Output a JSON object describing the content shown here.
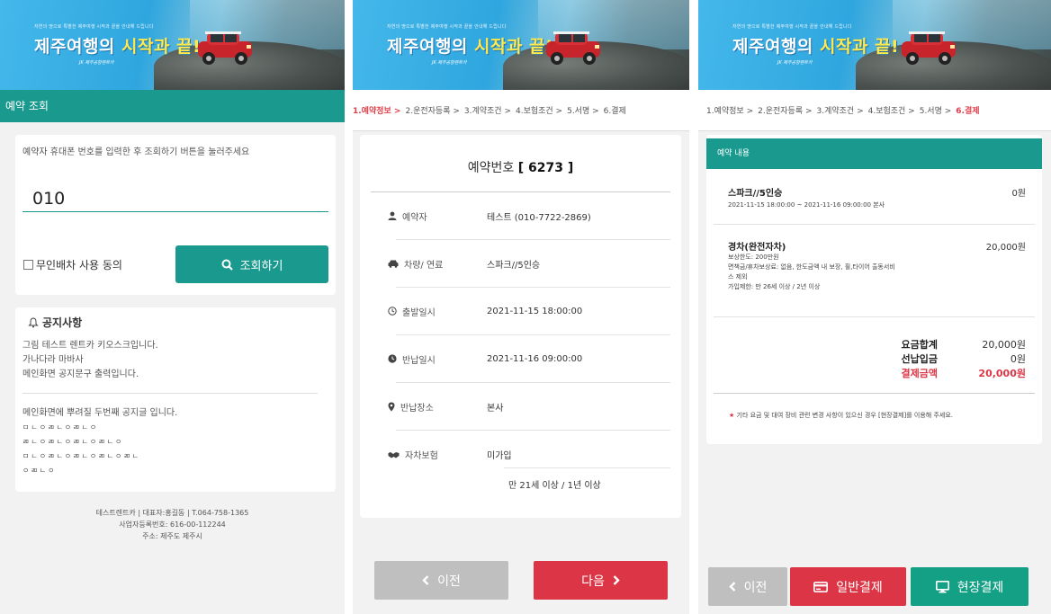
{
  "banner": {
    "small_text": "자연의 땅으로 특별한 제주여행 시작과 끝을 안내해 드립니다",
    "title_part1": "제주여행의 ",
    "title_part2": "시작과 끝!",
    "logo_text": "JK 제주공항렌트카"
  },
  "panel1": {
    "header": "예약 조회",
    "instruction": "예약자 휴대폰 번호를 입력한 후 조회하기 버튼을 눌러주세요",
    "phone_value": "010",
    "agree_label": "무인배차 사용 동의",
    "search_button": "조회하기",
    "notice_title": "공지사항",
    "notice_lines": [
      "그림 테스트 렌트카 키오스크입니다.",
      "가나다라 마바사",
      "메인화면 공지문구 출력입니다."
    ],
    "notice2_title": "메인화면에 뿌려질 두번째 공지글 입니다.",
    "notice2_jamo": [
      "ㅁㄴㅇㄻㄴㅇㄻㄴㅇ",
      "ㄻㄴㅇㄻㄴㅇㄻㄴㅇㄻㄴㅇ",
      "ㅁㄴㅇㄻㄴㅇㄻㄴㅇㄻㄴㅇㄻㄴ",
      "ㅇㄻㄴㅇ"
    ],
    "footer": [
      "테스트렌트카 | 대표자:홍길동 | T.064-758-1365",
      "사업자등록번호: 616-00-112244",
      "주소: 제주도 제주시"
    ]
  },
  "steps": [
    "1.예약정보 >",
    "2.운전자등록 >",
    "3.계약조건 >",
    "4.보험조건 >",
    "5.서명 >",
    "6.결제"
  ],
  "panel2": {
    "title_prefix": "예약번호 ",
    "reservation_no": "[ 6273 ]",
    "rows": [
      {
        "label": "예약자",
        "value": "테스트 (010-7722-2869)"
      },
      {
        "label": "차량/ 연료",
        "value": "스파크//5인승"
      },
      {
        "label": "출발일시",
        "value": "2021-11-15 18:00:00"
      },
      {
        "label": "반납일시",
        "value": "2021-11-16 09:00:00"
      },
      {
        "label": "반납장소",
        "value": "본사"
      },
      {
        "label": "자차보험",
        "value": "미가입"
      }
    ],
    "insurance_sub": "만 21세 이상 / 1년 이상",
    "prev_button": "이전",
    "next_button": "다음"
  },
  "panel3": {
    "header": "예약 내용",
    "item1": {
      "name": "스파크//5인승",
      "price": "0원",
      "detail": "2021-11-15 18:00:00 ~ 2021-11-16 09:00:00 본사"
    },
    "item2": {
      "name": "경차(완전자차)",
      "price": "20,000원",
      "details": [
        "보상한도: 200만원",
        "면책금/휴차보상료: 없음, 한도금액 내 보장, 휠,타이어 출동서비",
        "스 제외",
        "가입제한: 만 26세 이상 / 2년 이상"
      ]
    },
    "summary": [
      {
        "label": "요금합계",
        "value": "20,000원"
      },
      {
        "label": "선납입금",
        "value": "0원"
      },
      {
        "label": "결제금액",
        "value": "20,000원"
      }
    ],
    "note_star": "★",
    "note": "기타 요금 및 대여 장비 관련 변경 사항이 있으신 경우 [현장결제]를 이용해 주세요.",
    "prev_button": "이전",
    "card_button": "일반결제",
    "onsite_button": "현장결제"
  },
  "colors": {
    "teal": "#1a9a8e",
    "red": "#dc3545",
    "green": "#14a085",
    "gray_button": "#bfbfbf"
  }
}
